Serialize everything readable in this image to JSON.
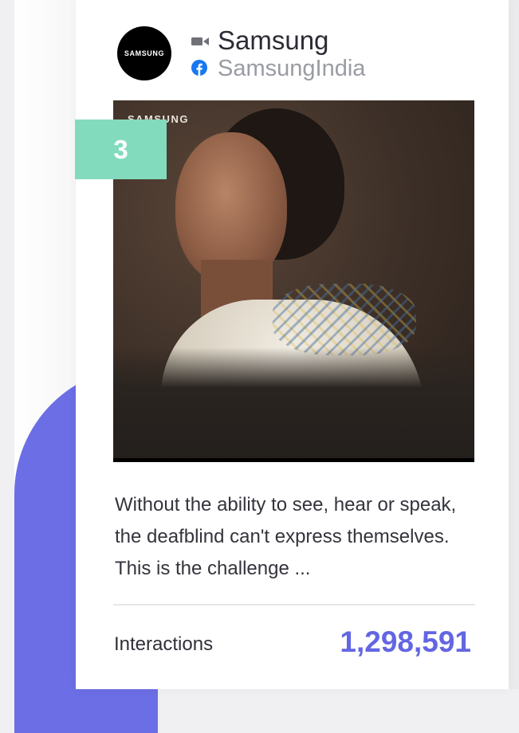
{
  "post": {
    "brand_name": "Samsung",
    "handle": "SamsungIndia",
    "avatar_text": "SAMSUNG",
    "media_watermark": "SAMSUNG",
    "rank": "3",
    "caption": "Without the ability to see, hear or speak, the deafblind can't express themselves. This is the challenge ...",
    "metric_label": "Interactions",
    "metric_value": "1,298,591"
  },
  "icons": {
    "post_type": "video-camera-icon",
    "platform": "facebook-icon"
  },
  "colors": {
    "accent": "#6366e2",
    "badge": "#82dbbd",
    "blob": "#6b6ee4",
    "facebook": "#1877f2"
  }
}
